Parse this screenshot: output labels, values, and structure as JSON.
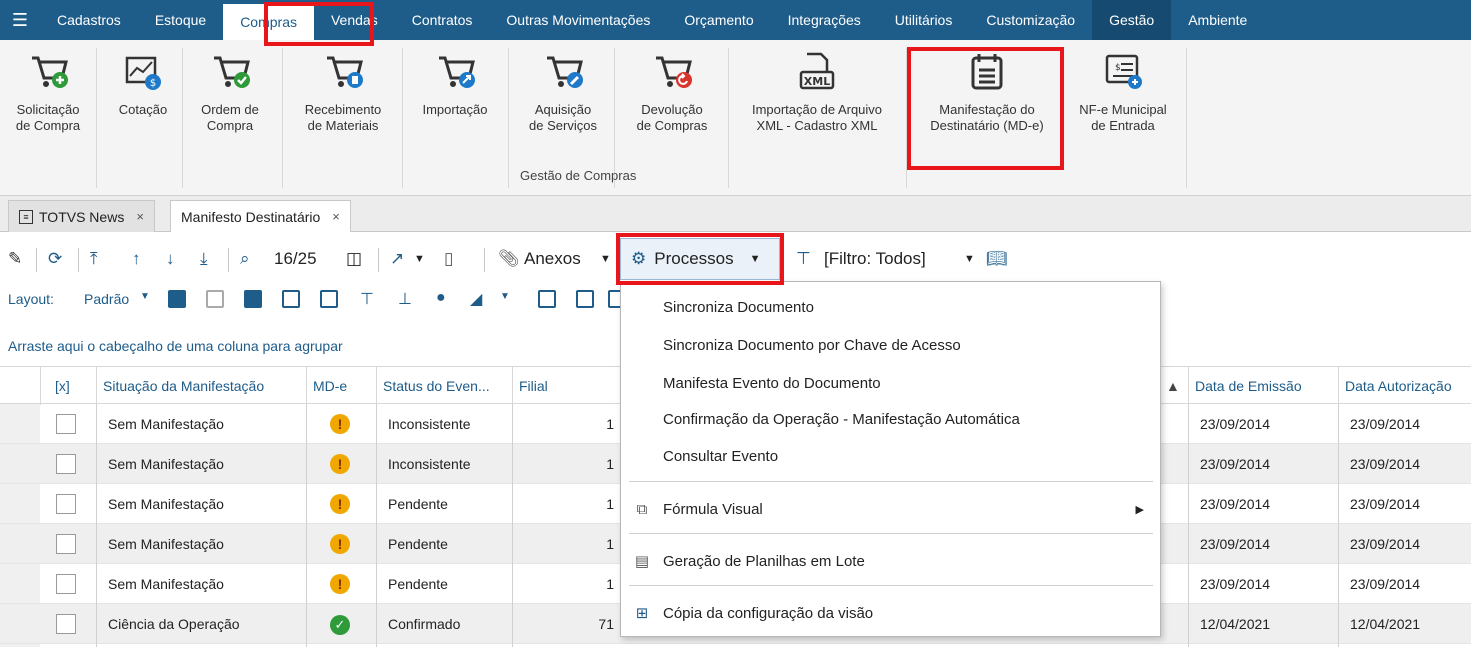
{
  "menu": {
    "items": [
      "Cadastros",
      "Estoque",
      "Compras",
      "Vendas",
      "Contratos",
      "Outras Movimentações",
      "Orçamento",
      "Integrações",
      "Utilitários",
      "Customização",
      "Gestão",
      "Ambiente"
    ],
    "active": "Compras"
  },
  "ribbon": {
    "buttons": [
      {
        "line1": "Solicitação",
        "line2": "de Compra",
        "icon": "cart-plus-icon"
      },
      {
        "line1": "Cotação",
        "line2": "",
        "icon": "quote-chart-icon"
      },
      {
        "line1": "Ordem de",
        "line2": "Compra",
        "icon": "cart-check-icon"
      },
      {
        "line1": "Recebimento",
        "line2": "de Materiais",
        "icon": "cart-receive-icon"
      },
      {
        "line1": "Importação",
        "line2": "",
        "icon": "cart-import-icon"
      },
      {
        "line1": "Aquisição",
        "line2": "de Serviços",
        "icon": "cart-wrench-icon"
      },
      {
        "line1": "Devolução",
        "line2": "de Compras",
        "icon": "cart-return-icon"
      },
      {
        "line1": "Importação de Arquivo",
        "line2": "XML - Cadastro XML",
        "icon": "xml-file-icon"
      },
      {
        "line1": "Manifestação do",
        "line2": "Destinatário (MD-e)",
        "icon": "calendar-list-icon"
      },
      {
        "line1": "NF-e Municipal",
        "line2": "de Entrada",
        "icon": "invoice-icon"
      }
    ],
    "group_label": "Gestão de Compras"
  },
  "tabs": [
    {
      "label": "TOTVS News",
      "close": "×"
    },
    {
      "label": "Manifesto Destinatário",
      "close": "×"
    }
  ],
  "toolbar": {
    "record_counter": "16/25",
    "attachments_label": "Anexos",
    "processes_label": "Processos",
    "filter_label": "[Filtro: Todos]",
    "layout_label": "Layout:",
    "layout_value": "Padrão"
  },
  "group_hint": "Arraste aqui o cabeçalho de uma coluna para agrupar",
  "grid": {
    "columns": [
      "[x]",
      "Situação da Manifestação",
      "MD-e",
      "Status do Even...",
      "Filial",
      "Data de Emissão",
      "Data Autorização"
    ],
    "rows": [
      {
        "situacao": "Sem Manifestação",
        "mde": "warning",
        "status": "Inconsistente",
        "filial": "1",
        "emissao": "23/09/2014",
        "autorizacao": "23/09/2014"
      },
      {
        "situacao": "Sem Manifestação",
        "mde": "warning",
        "status": "Inconsistente",
        "filial": "1",
        "emissao": "23/09/2014",
        "autorizacao": "23/09/2014"
      },
      {
        "situacao": "Sem Manifestação",
        "mde": "warning",
        "status": "Pendente",
        "filial": "1",
        "emissao": "23/09/2014",
        "autorizacao": "23/09/2014"
      },
      {
        "situacao": "Sem Manifestação",
        "mde": "warning",
        "status": "Pendente",
        "filial": "1",
        "emissao": "23/09/2014",
        "autorizacao": "23/09/2014"
      },
      {
        "situacao": "Sem Manifestação",
        "mde": "warning",
        "status": "Pendente",
        "filial": "1",
        "emissao": "23/09/2014",
        "autorizacao": "23/09/2014"
      },
      {
        "situacao": "Ciência da Operação",
        "mde": "ok",
        "status": "Confirmado",
        "filial": "71",
        "emissao": "12/04/2021",
        "autorizacao": "12/04/2021"
      }
    ]
  },
  "dropdown": {
    "items": [
      "Sincroniza Documento",
      "Sincroniza Documento por Chave de Acesso",
      "Manifesta Evento do Documento",
      "Confirmação da Operação - Manifestação Automática",
      "Consultar Evento",
      "Fórmula Visual",
      "Geração de Planilhas em Lote",
      "Cópia da configuração da visão"
    ]
  },
  "colors": {
    "brand": "#1e5c8a",
    "highlight": "#e8161b",
    "success": "#2e9a3a",
    "warning": "#f0a800"
  }
}
